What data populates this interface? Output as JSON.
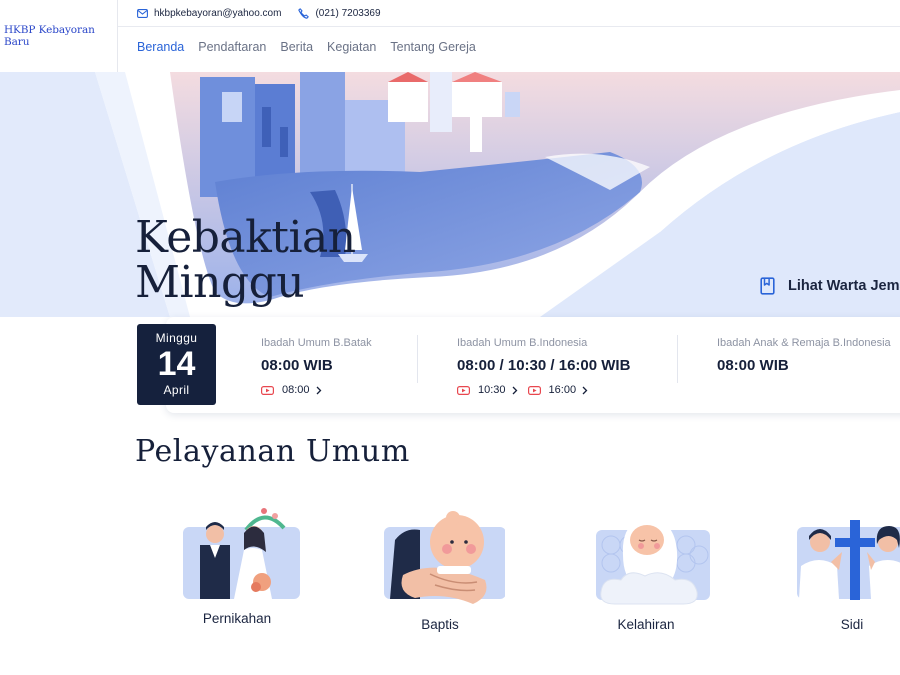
{
  "brand": {
    "name": "HKBP Kebayoran Baru"
  },
  "contact": {
    "email": "hkbpkebayoran@yahoo.com",
    "phone": "(021) 7203369"
  },
  "nav": [
    {
      "label": "Beranda",
      "active": true
    },
    {
      "label": "Pendaftaran",
      "active": false
    },
    {
      "label": "Berita",
      "active": false
    },
    {
      "label": "Kegiatan",
      "active": false
    },
    {
      "label": "Tentang Gereja",
      "active": false
    }
  ],
  "hero": {
    "title_line1": "Kebaktian",
    "title_line2": "Minggu",
    "warta_label": "Lihat Warta Jemaat"
  },
  "date": {
    "day": "Minggu",
    "number": "14",
    "month": "April"
  },
  "services": [
    {
      "name": "Ibadah Umum B.Batak",
      "time": "08:00 WIB",
      "streams": [
        "08:00"
      ]
    },
    {
      "name": "Ibadah Umum B.Indonesia",
      "time": "08:00 / 10:30 / 16:00 WIB",
      "streams": [
        "10:30",
        "16:00"
      ]
    },
    {
      "name": "Ibadah Anak & Remaja B.Indonesia",
      "time": "08:00 WIB",
      "streams": []
    }
  ],
  "pelayanan": {
    "title": "Pelayanan Umum",
    "items": [
      {
        "label": "Pernikahan",
        "icon": "wedding-illustration"
      },
      {
        "label": "Baptis",
        "icon": "baby-baptism-illustration"
      },
      {
        "label": "Kelahiran",
        "icon": "newborn-illustration"
      },
      {
        "label": "Sidi",
        "icon": "confirmation-prayer-illustration"
      }
    ]
  },
  "colors": {
    "accent": "#2a64d8",
    "navy": "#15213d",
    "hero_light": "#e4ecfb",
    "hero_blue": "#7f9bdb",
    "youtube_red": "#e8474f"
  }
}
